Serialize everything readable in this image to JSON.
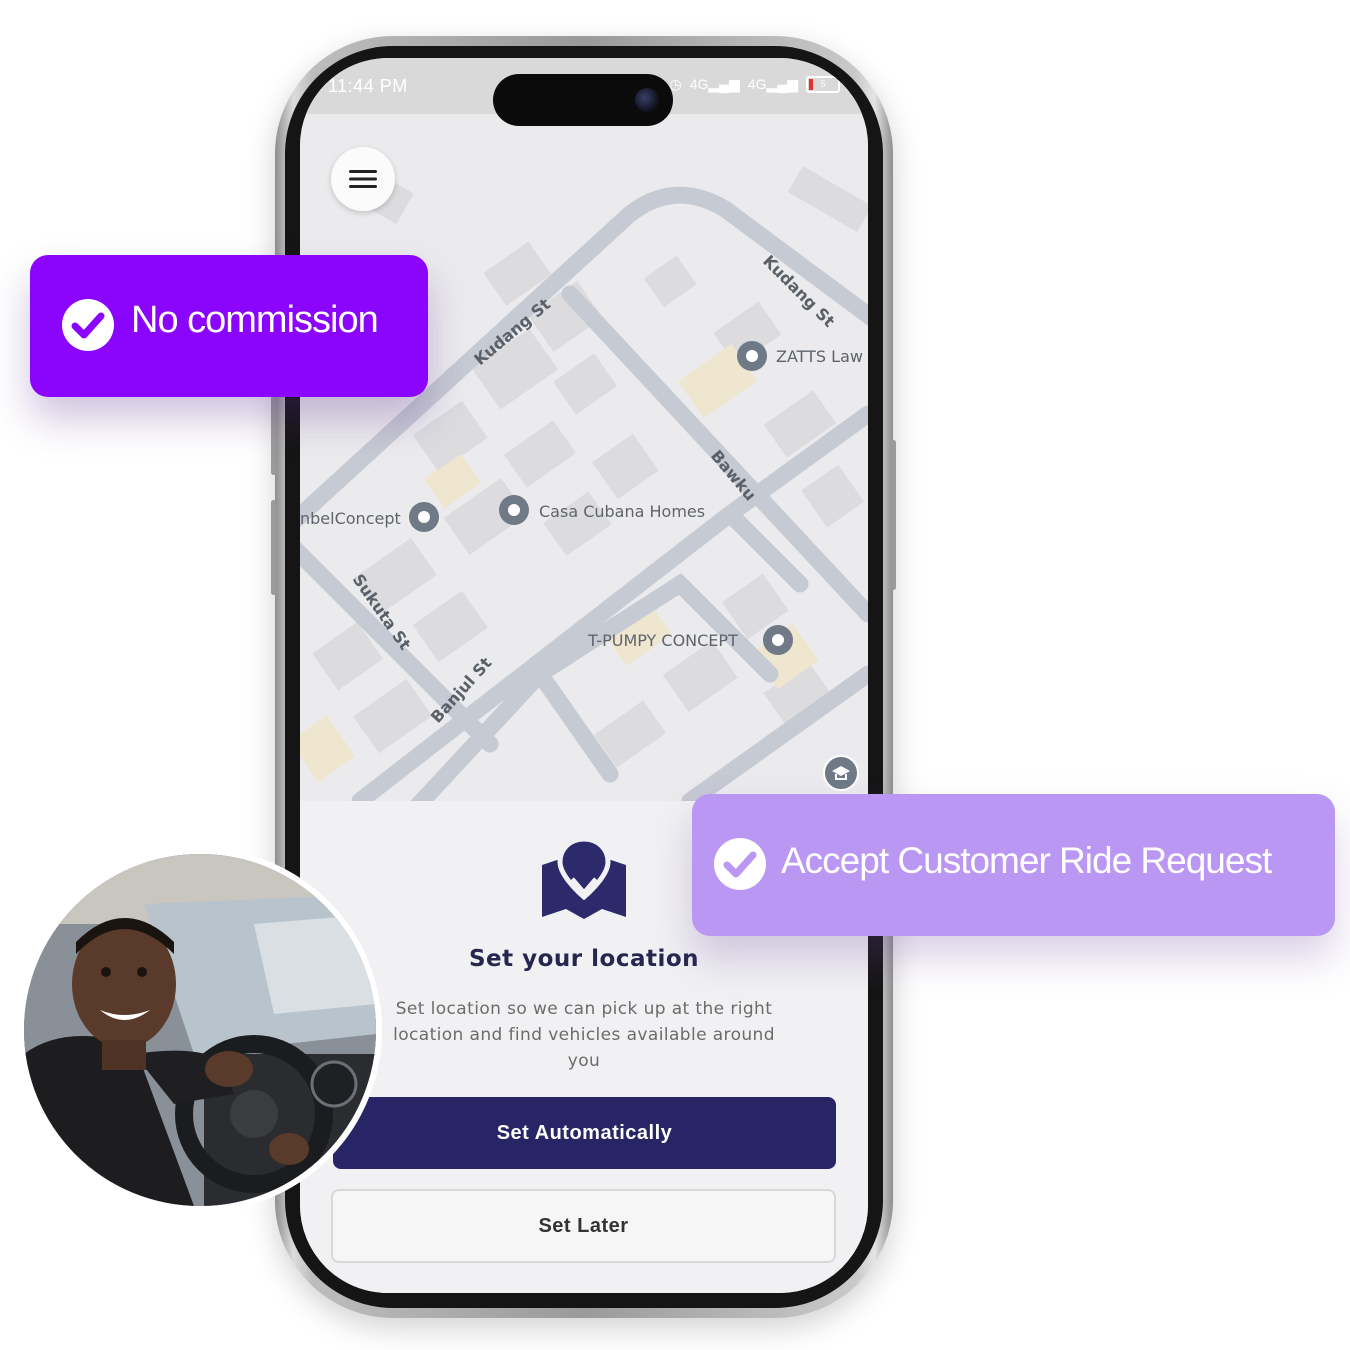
{
  "status_bar": {
    "time": "11:44 PM",
    "network_1": "4G",
    "network_2": "4G",
    "battery": "5"
  },
  "map": {
    "streets": [
      "Kudang St",
      "Kudang St",
      "Bawku",
      "Sukuta St",
      "Banjul St"
    ],
    "places": [
      "ZATTS Law",
      "Casa Cubana Homes",
      "nbelConcept",
      "T-PUMPY CONCEPT"
    ],
    "menu_icon": "hamburger-menu-icon"
  },
  "sheet": {
    "icon": "map-location-pin-icon",
    "title": "Set your location",
    "description": "Set location so we can pick up at the right location  and find vehicles available around you",
    "primary_button": "Set Automatically",
    "secondary_button": "Set Later"
  },
  "badges": {
    "first": "No commission",
    "second": "Accept Customer Ride Request"
  },
  "colors": {
    "badge_primary": "#8b04fc",
    "badge_secondary": "#ba97f2",
    "button_primary": "#282567",
    "title_text": "#26274f"
  },
  "driver_photo": "smiling-driver-photo"
}
